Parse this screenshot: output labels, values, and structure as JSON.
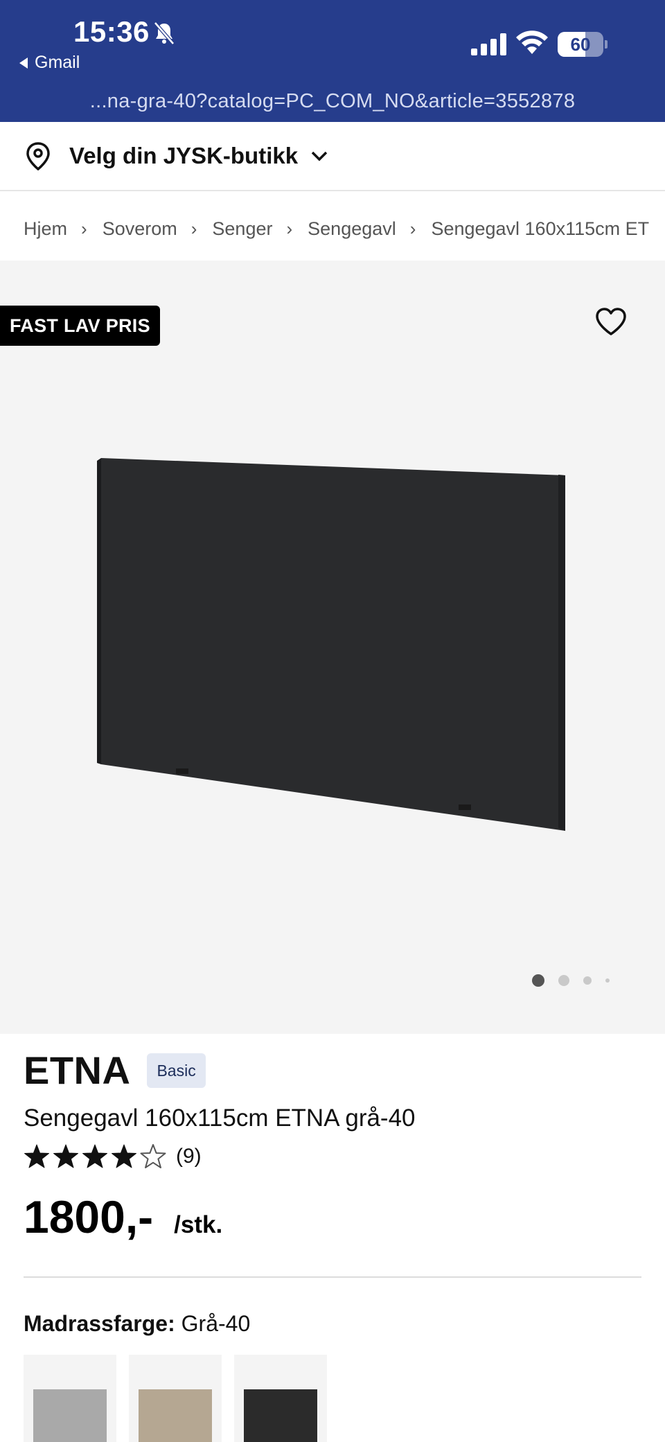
{
  "status": {
    "time": "15:36",
    "back_app": "Gmail",
    "battery_percent": "60",
    "battery_level": 0.6
  },
  "url": "...na-gra-40?catalog=PC_COM_NO&article=3552878",
  "store_selector": {
    "label": "Velg din JYSK-butikk"
  },
  "breadcrumb": {
    "items": [
      "Hjem",
      "Soverom",
      "Senger",
      "Sengegavl",
      "Sengegavl 160x115cm ET"
    ]
  },
  "gallery": {
    "badge": "FAST LAV PRIS",
    "image_count": 4,
    "active_index": 0
  },
  "product": {
    "brand": "ETNA",
    "tier": "Basic",
    "title": "Sengegavl 160x115cm ETNA grå-40",
    "rating": 4,
    "rating_max": 5,
    "review_count": "(9)",
    "price": "1800,-",
    "unit": "/stk."
  },
  "color_option": {
    "label": "Madrassfarge:",
    "value": "Grå-40",
    "swatches": [
      {
        "name": "light-grey",
        "color": "#a9a9a9"
      },
      {
        "name": "beige",
        "color": "#b5a792"
      },
      {
        "name": "dark-grey",
        "color": "#2b2b2b"
      }
    ]
  },
  "colors": {
    "header_bg": "#263d8c",
    "gallery_bg": "#f4f4f4",
    "badge_bg": "#000000",
    "tier_bg": "#e3e8f3"
  }
}
